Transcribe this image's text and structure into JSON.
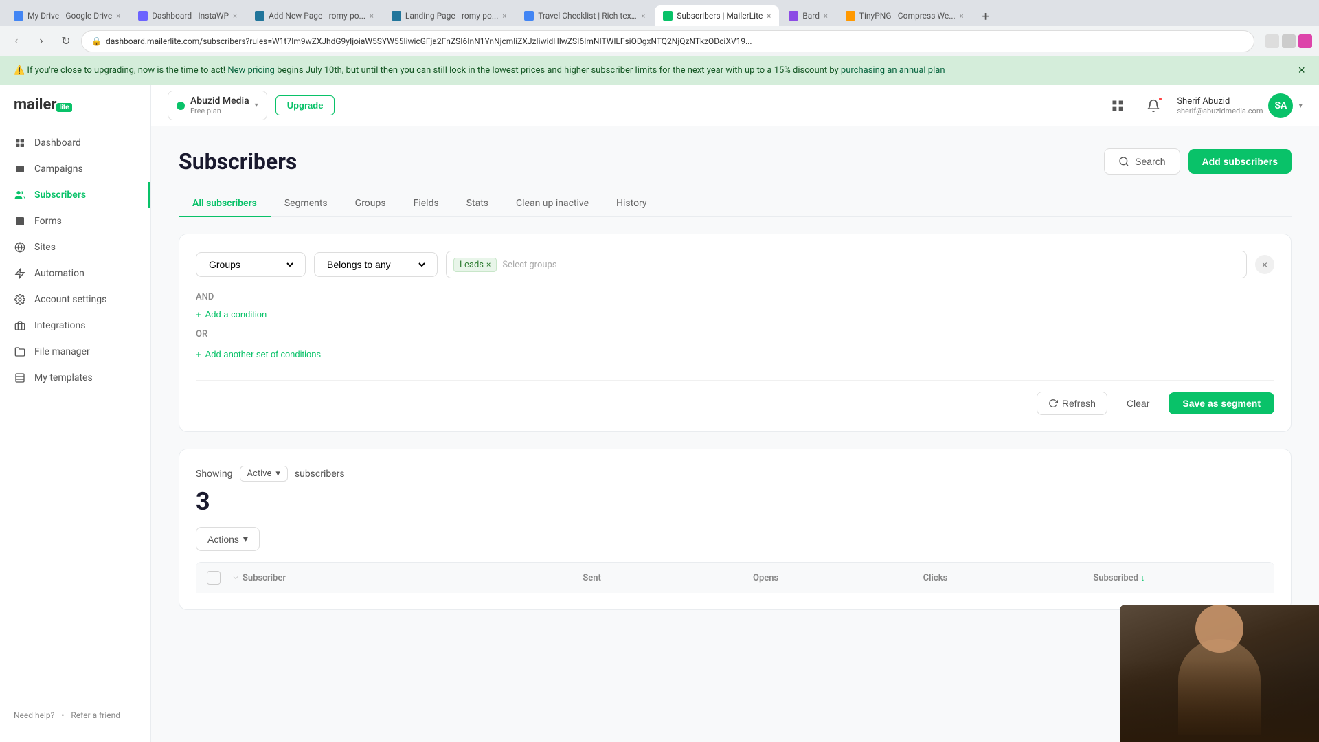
{
  "browser": {
    "tabs": [
      {
        "label": "My Drive - Google Drive",
        "favicon_color": "#4285f4",
        "active": false
      },
      {
        "label": "Dashboard - InstaWP",
        "favicon_color": "#6c63ff",
        "active": false
      },
      {
        "label": "Add New Page - romy-po...",
        "favicon_color": "#21759b",
        "active": false
      },
      {
        "label": "Landing Page - romy-po...",
        "favicon_color": "#21759b",
        "active": false
      },
      {
        "label": "Travel Checklist | Rich tex...",
        "favicon_color": "#4285f4",
        "active": false
      },
      {
        "label": "Subscribers | MailerLite",
        "favicon_color": "#09c269",
        "active": true
      },
      {
        "label": "Bard",
        "favicon_color": "#8c4be5",
        "active": false
      },
      {
        "label": "TinyPNG - Compress We...",
        "favicon_color": "#ff9800",
        "active": false
      }
    ],
    "url": "dashboard.mailerlite.com/subscribers?rules=W1t7Im9wZXJhdG9yIjoiaW5SYW55IiwicGFja2FnZSI6InN1YnNjcmliZXJzIiwidHlwZSI6ImNITWlLFsiODgxNTQ2NjQzNTkzODciXV19..."
  },
  "notification": {
    "text": "If you're close to upgrading, now is the time to act!",
    "link_text": "New pricing",
    "suffix": " begins July 10th, but until then you can still lock in the lowest prices and higher subscriber limits for the next year with up to a 15% discount by ",
    "link2_text": "purchasing an annual plan"
  },
  "sidebar": {
    "logo_text": "mailer",
    "logo_lite": "lite",
    "nav_items": [
      {
        "label": "Dashboard",
        "icon": "dashboard"
      },
      {
        "label": "Campaigns",
        "icon": "campaigns"
      },
      {
        "label": "Subscribers",
        "icon": "subscribers",
        "active": true
      },
      {
        "label": "Forms",
        "icon": "forms"
      },
      {
        "label": "Sites",
        "icon": "sites"
      },
      {
        "label": "Automation",
        "icon": "automation"
      },
      {
        "label": "Account settings",
        "icon": "settings"
      },
      {
        "label": "Integrations",
        "icon": "integrations"
      },
      {
        "label": "File manager",
        "icon": "file"
      },
      {
        "label": "My templates",
        "icon": "templates"
      }
    ],
    "footer_links": [
      {
        "label": "Need help?"
      },
      {
        "label": "Refer a friend"
      }
    ]
  },
  "topbar": {
    "workspace_name": "Abuzid Media",
    "workspace_plan": "Free plan",
    "upgrade_label": "Upgrade",
    "user_name": "Sherif Abuzid",
    "user_email": "sherif@abuzidmedia.com",
    "user_initials": "SA"
  },
  "page": {
    "title": "Subscribers",
    "search_label": "Search",
    "add_subscribers_label": "Add subscribers"
  },
  "tabs": [
    {
      "label": "All subscribers",
      "active": true
    },
    {
      "label": "Segments",
      "active": false
    },
    {
      "label": "Groups",
      "active": false
    },
    {
      "label": "Fields",
      "active": false
    },
    {
      "label": "Stats",
      "active": false
    },
    {
      "label": "Clean up inactive",
      "active": false
    },
    {
      "label": "History",
      "active": false
    }
  ],
  "filter": {
    "group_dropdown": "Groups",
    "condition_dropdown": "Belongs to any",
    "tag_label": "Leads",
    "tag_placeholder": "Select groups",
    "and_label": "AND",
    "add_condition_label": "+ Add a condition",
    "or_label": "OR",
    "add_conditions_label": "+ Add another set of conditions",
    "refresh_label": "Refresh",
    "clear_label": "Clear",
    "save_segment_label": "Save as segment"
  },
  "results": {
    "showing_label": "Showing",
    "active_label": "Active",
    "subscribers_label": "subscribers",
    "count": "3",
    "actions_label": "Actions",
    "table_headers": [
      {
        "label": "Subscriber",
        "sortable": false
      },
      {
        "label": "Sent",
        "sortable": false
      },
      {
        "label": "Opens",
        "sortable": false
      },
      {
        "label": "Clicks",
        "sortable": false
      },
      {
        "label": "Subscribed",
        "sortable": true,
        "sort_dir": "desc"
      }
    ]
  }
}
